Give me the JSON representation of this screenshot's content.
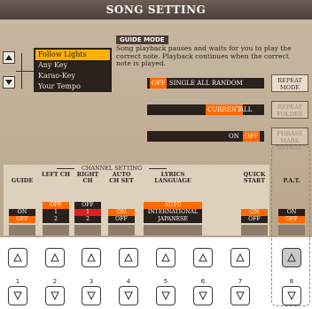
{
  "window": {
    "title": "SONG SETTING"
  },
  "guide_mode": {
    "label": "GUIDE MODE",
    "description": "Song playback pauses and waits for you to play the correct note. Playback continues when the correct note is played.",
    "items": [
      "Follow Lights",
      "Any Key",
      "Karao-Key",
      "Your Tempo"
    ],
    "selected": "Follow Lights"
  },
  "repeat": {
    "off": "OFF",
    "options": "SINGLE  ALL  RANDOM",
    "button": "REPEAT MODE"
  },
  "folder": {
    "current": "CURRENT",
    "all": "ALL",
    "button": "REPEAT FOLDER"
  },
  "phrase": {
    "on": "ON",
    "off": "OFF",
    "button": "PHRASE MARK REPEAT"
  },
  "channel_setting": {
    "label": "CHANNEL SETTING"
  },
  "columns": [
    {
      "head": "GUIDE",
      "opts": [
        "ON",
        "OFF"
      ],
      "sel": "OFF"
    },
    {
      "head": "LEFT CH",
      "opts": [
        "OFF",
        "1",
        "2"
      ],
      "sel": "OFF"
    },
    {
      "head": "RIGHT CH",
      "opts": [
        "OFF",
        "1",
        "2"
      ],
      "sel": "1"
    },
    {
      "head": "AUTO CH SET",
      "opts": [
        "ON",
        "OFF"
      ],
      "sel": "ON"
    },
    {
      "head": "LYRICS LANGUAGE",
      "opts": [
        "AUTO",
        "INTERNATIONAL",
        "JAPANESE"
      ],
      "sel": "AUTO"
    },
    {
      "head": "QUICK START",
      "opts": [
        "ON",
        "OFF"
      ],
      "sel": "ON"
    },
    {
      "head": "P.A.T.",
      "opts": [
        "ON",
        "OFF"
      ],
      "sel": "OFF"
    }
  ],
  "hardware_buttons": [
    "1",
    "2",
    "3",
    "4",
    "5",
    "6",
    "7",
    "8"
  ],
  "colors": {
    "accent": "#ff6a00",
    "highlight": "#ffb000",
    "title_bg": "#4c3f39"
  }
}
